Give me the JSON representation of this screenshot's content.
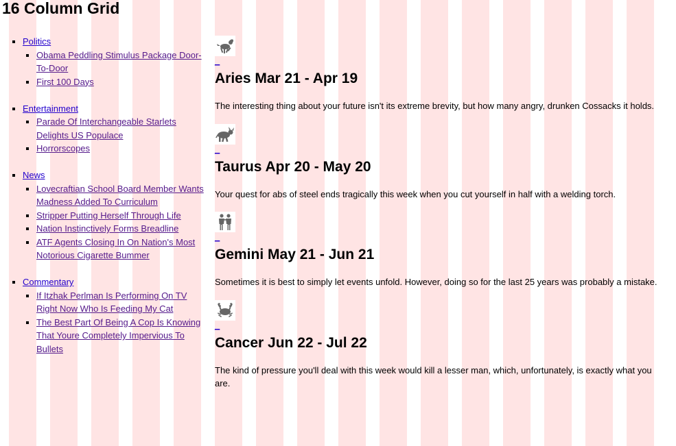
{
  "page": {
    "title": "16 Column Grid",
    "grid_color": "#ffe4e4",
    "link_color": "#2200cc",
    "visited_link_color": "#551a8b"
  },
  "sidebar": {
    "categories": [
      {
        "label": "Politics",
        "items": [
          "Obama Peddling Stimulus Package Door-To-Door",
          "First 100 Days"
        ]
      },
      {
        "label": "Entertainment",
        "items": [
          "Parade Of Interchangeable Starlets Delights US Populace",
          "Horrorscopes"
        ]
      },
      {
        "label": "News",
        "items": [
          "Lovecraftian School Board Member Wants Madness Added To Curriculum",
          "Stripper Putting Herself Through Life",
          "Nation Instinctively Forms Breadline",
          "ATF Agents Closing In On Nation's Most Notorious Cigarette Bummer"
        ]
      },
      {
        "label": "Commentary",
        "items": [
          "If Itzhak Perlman Is Performing On TV Right Now Who Is Feeding My Cat",
          "The Best Part Of Being A Cop Is Knowing That Youre Completely Impervious To Bullets"
        ]
      }
    ]
  },
  "horoscopes": [
    {
      "icon": "aries-ram-icon",
      "heading": "Aries Mar 21 - Apr 19",
      "text": "The interesting thing about your future isn't its extreme brevity, but how many angry, drunken Cossacks it holds."
    },
    {
      "icon": "taurus-bull-icon",
      "heading": "Taurus Apr 20 - May 20",
      "text": "Your quest for abs of steel ends tragically this week when you cut yourself in half with a welding torch."
    },
    {
      "icon": "gemini-twins-icon",
      "heading": "Gemini May 21 - Jun 21",
      "text": "Sometimes it is best to simply let events unfold. However, doing so for the last 25 years was probably a mistake."
    },
    {
      "icon": "cancer-crab-icon",
      "heading": "Cancer Jun 22 - Jul 22",
      "text": "The kind of pressure you'll deal with this week would kill a lesser man, which, unfortunately, is exactly what you are."
    }
  ]
}
